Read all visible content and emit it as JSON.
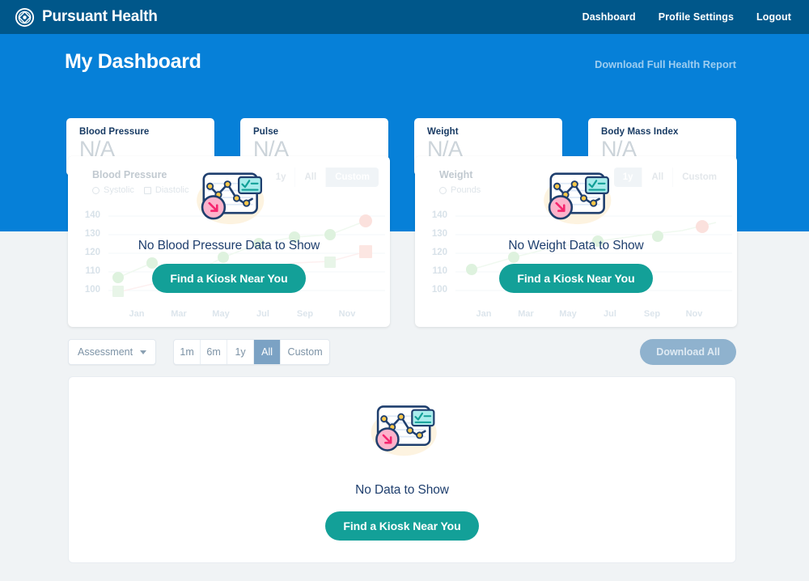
{
  "nav": {
    "logo_icon": "pursuant-emblem-icon",
    "brand": "Pursuant Health",
    "links": [
      {
        "label": "Dashboard"
      },
      {
        "label": "Profile Settings"
      },
      {
        "label": "Logout"
      }
    ]
  },
  "hero": {
    "title": "My Dashboard",
    "report_link": "Download Full Health Report"
  },
  "stats": [
    {
      "label": "Blood Pressure",
      "value": "N/A"
    },
    {
      "label": "Pulse",
      "value": "N/A"
    },
    {
      "label": "Weight",
      "value": "N/A"
    },
    {
      "label": "Body Mass Index",
      "value": "N/A"
    }
  ],
  "bp_card": {
    "title": "Blood Pressure",
    "options": [
      {
        "label": "Systolic",
        "type": "radio"
      },
      {
        "label": "Diastolic",
        "type": "checkbox"
      }
    ],
    "ranges": [
      {
        "label": "1y",
        "selected": false
      },
      {
        "label": "All",
        "selected": false
      },
      {
        "label": "Custom",
        "selected": true
      }
    ],
    "empty_message": "No Blood Pressure Data to Show",
    "kiosk_button": "Find a Kiosk Near You"
  },
  "weight_card": {
    "title": "Weight",
    "options": [
      {
        "label": "Pounds",
        "type": "radio"
      }
    ],
    "ranges": [
      {
        "label": "1y",
        "selected": true
      },
      {
        "label": "All",
        "selected": false
      },
      {
        "label": "Custom",
        "selected": false
      }
    ],
    "empty_message": "No Weight Data to Show",
    "kiosk_button": "Find a Kiosk Near You"
  },
  "toolbar": {
    "assessment_select": "Assessment",
    "caret_icon": "chevron-down-icon",
    "segments": [
      {
        "label": "1m",
        "selected": false
      },
      {
        "label": "6m",
        "selected": false
      },
      {
        "label": "1y",
        "selected": false
      },
      {
        "label": "All",
        "selected": true
      },
      {
        "label": "Custom",
        "selected": false
      }
    ],
    "download_all": "Download All"
  },
  "empty_panel": {
    "illustration_icon": "no-data-chart-illustration",
    "message": "No Data to Show",
    "kiosk_button": "Find a Kiosk Near You"
  },
  "chart_data": {
    "type": "line",
    "title": "Blood Pressure",
    "state": "empty",
    "xlabel": "",
    "ylabel": "",
    "ylim": [
      95,
      145
    ],
    "yticks": [
      "140",
      "130",
      "120",
      "110",
      "100"
    ],
    "xticks": [
      "Jan",
      "Mar",
      "May",
      "Jul",
      "Sep",
      "Nov"
    ],
    "grid": true,
    "legend": [
      "Systolic",
      "Diastolic"
    ],
    "series": [
      {
        "name": "Systolic",
        "marker": "circle",
        "color": "#cdeccd",
        "values": [
          null,
          null,
          null,
          null,
          null,
          null
        ]
      },
      {
        "name": "Diastolic",
        "marker": "square",
        "color": "#cdeccd",
        "values": [
          null,
          null,
          null,
          null,
          null,
          null
        ]
      }
    ],
    "note": "Placeholder faded sample plot; no real data rendered"
  },
  "colors": {
    "nav_blue": "#00578a",
    "hero_blue": "#0680d8",
    "page_bg": "#f0f3f5",
    "teal_accent": "#13a098",
    "navy_text": "#1f3f6e",
    "muted": "#9fb2c0"
  }
}
